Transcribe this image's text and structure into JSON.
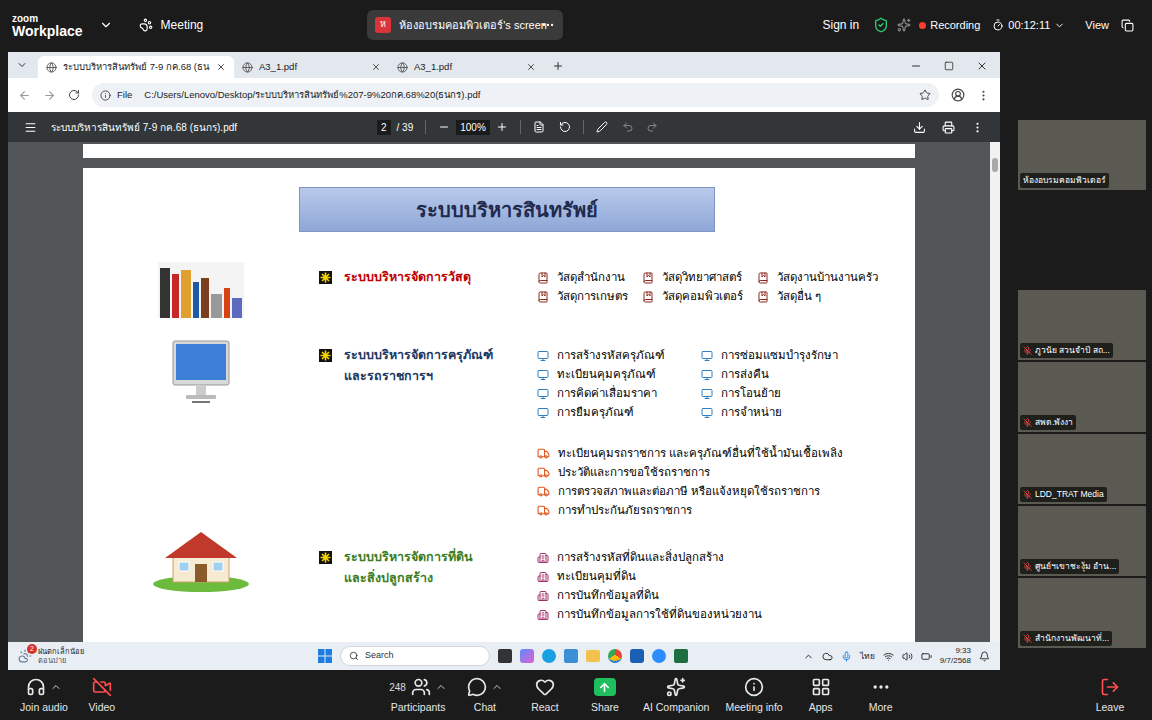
{
  "zoom_bar": {
    "brand": "zoom",
    "product": "Workplace",
    "menu": "Meeting",
    "share_tab": {
      "avatar": "ห",
      "label": "ห้องอบรมคอมพิวเตอร์'s screen"
    },
    "sign_in": "Sign in",
    "recording": "Recording",
    "timer": "00:12:11",
    "view": "View"
  },
  "browser": {
    "tabs": [
      {
        "label": "ระบบบริหารสินทรัพย์ 7-9 กค.68 (ธน",
        "selected": true
      },
      {
        "label": "A3_1.pdf",
        "selected": false
      },
      {
        "label": "A3_1.pdf",
        "selected": false
      }
    ],
    "address": {
      "scheme": "File",
      "path": "C:/Users/Lenovo/Desktop/ระบบบริหารสินทรัพย์%207-9%20กค.68%20(ธนกร).pdf"
    }
  },
  "pdf_viewer": {
    "filename": "ระบบบริหารสินทรัพย์ 7-9 กค.68 (ธนกร).pdf",
    "page": "2",
    "page_total": "/ 39",
    "zoom": "100%"
  },
  "document": {
    "title": "ระบบบริหารสินทรัพย์",
    "sections": [
      {
        "kind": "materials",
        "name_lines": [
          "ระบบบริหารจัดการวัสดุ"
        ],
        "color": "#c00000",
        "items": [
          "วัสดุสำนักงาน",
          "วัสดุวิทยาศาสตร์",
          "วัสดุงานบ้านงานครัว",
          "วัสดุการเกษตร",
          "วัสดุคอมพิวเตอร์",
          "วัสดุอื่น ๆ"
        ],
        "vehicle_items": []
      },
      {
        "kind": "equipment",
        "name_lines": [
          "ระบบบริหารจัดการครุภัณฑ์",
          "และรถราชการฯ"
        ],
        "color": "#203864",
        "items": [
          "การสร้างรหัสครุภัณฑ์",
          "การซ่อมแซมบำรุงรักษา",
          "ทะเบียนคุมครุภัณฑ์",
          "การส่งคืน",
          "การคิดค่าเสื่อมราคา",
          "การโอนย้าย",
          "การยืมครุภัณฑ์",
          "การจำหน่าย"
        ],
        "vehicle_items": [
          "ทะเบียนคุมรถราชการ และครุภัณฑ์อื่นที่ใช้น้ำมันเชื้อเพลิง",
          "ประวัติและการขอใช้รถราชการ",
          "การตรวจสภาพและต่อภาษี หรือแจ้งหยุดใช้รถราชการ",
          "การทำประกันภัยรถราชการ"
        ]
      },
      {
        "kind": "land",
        "name_lines": [
          "ระบบบริหารจัดการที่ดิน",
          "และสิ่งปลูกสร้าง"
        ],
        "color": "#3b7d23",
        "items": [
          "การสร้างรหัสที่ดินและสิ่งปลูกสร้าง",
          "ทะเบียนคุมที่ดิน",
          "การบันทึกข้อมูลที่ดิน",
          "การบันทึกข้อมูลการใช้ที่ดินของหน่วยงาน"
        ],
        "vehicle_items": []
      }
    ]
  },
  "taskbar": {
    "weather": {
      "badge": "2",
      "line1": "ฝนตกเล็กน้อย",
      "line2": "ตอนบ่าย"
    },
    "search": "Search",
    "language": "ไทย",
    "time": "9:33",
    "date": "9/7/2568"
  },
  "participants": [
    {
      "name": "ห้องอบรมคอมพิวเตอร์",
      "muted": false
    },
    {
      "name": "ภูวนัย สวนจำปี สถ...",
      "muted": true
    },
    {
      "name": "สพด.พังงา",
      "muted": true
    },
    {
      "name": "LDD_TRAT Media",
      "muted": true
    },
    {
      "name": "ศูนย์ฯเขาชะงุ้ม อำน...",
      "muted": true
    },
    {
      "name": "สำนักงานพัฒนาที่...",
      "muted": true
    }
  ],
  "toolbar": [
    {
      "kind": "audio",
      "label": "Join audio",
      "count": ""
    },
    {
      "kind": "video",
      "label": "Video",
      "count": ""
    },
    {
      "kind": "participants",
      "label": "Participants",
      "count": "248"
    },
    {
      "kind": "chat",
      "label": "Chat",
      "count": ""
    },
    {
      "kind": "react",
      "label": "React",
      "count": ""
    },
    {
      "kind": "share",
      "label": "Share",
      "count": ""
    },
    {
      "kind": "ai",
      "label": "AI Companion",
      "count": ""
    },
    {
      "kind": "info",
      "label": "Meeting info",
      "count": ""
    },
    {
      "kind": "apps",
      "label": "Apps",
      "count": ""
    },
    {
      "kind": "more",
      "label": "More",
      "count": ""
    },
    {
      "kind": "leave",
      "label": "Leave",
      "count": ""
    }
  ]
}
